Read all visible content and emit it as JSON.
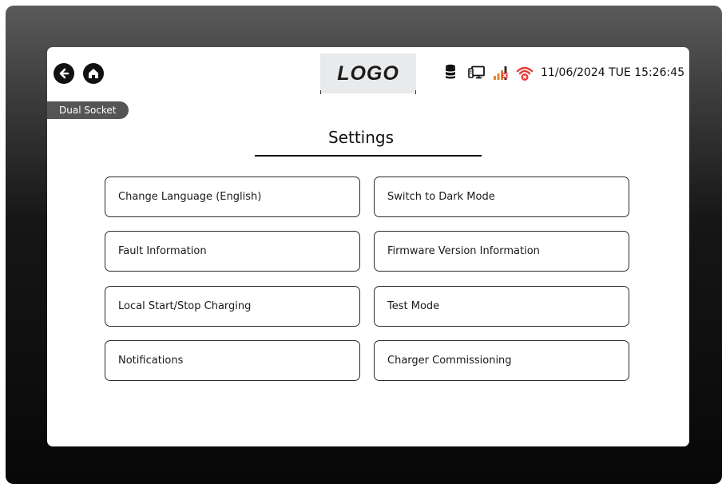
{
  "header": {
    "logo": "LOGO",
    "datetime": "11/06/2024 TUE 15:26:45",
    "status_icons": [
      "database-icon",
      "computer-icon",
      "signal-bars-error-icon",
      "wifi-error-icon"
    ],
    "nav_icons": [
      "back-arrow-icon",
      "home-icon"
    ]
  },
  "badge": "Dual Socket",
  "page": {
    "title": "Settings"
  },
  "options": [
    {
      "label": "Change Language (English)"
    },
    {
      "label": "Switch to Dark Mode"
    },
    {
      "label": "Fault Information"
    },
    {
      "label": "Firmware Version Information"
    },
    {
      "label": "Local Start/Stop Charging"
    },
    {
      "label": "Test Mode"
    },
    {
      "label": "Notifications"
    },
    {
      "label": "Charger Commissioning"
    }
  ],
  "colors": {
    "accent_error": "#e53935",
    "signal_orange": "#e08a2c",
    "text": "#111111",
    "badge_bg": "#555555",
    "logo_bg": "#e8eaec"
  }
}
